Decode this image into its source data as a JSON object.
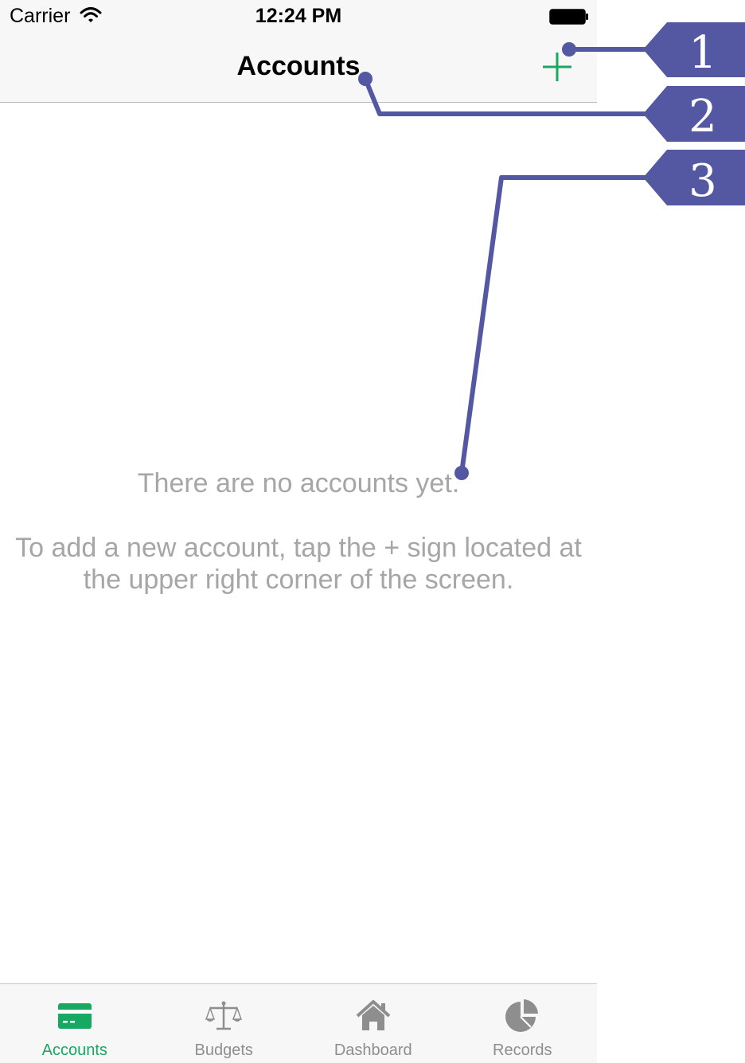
{
  "status_bar": {
    "carrier": "Carrier",
    "time": "12:24 PM"
  },
  "nav": {
    "title": "Accounts",
    "add_icon": "plus-icon"
  },
  "empty_state": {
    "title": "There are no accounts yet.",
    "hint": "To add a new account, tap the + sign located at the upper right corner of the screen."
  },
  "tabs": [
    {
      "label": "Accounts",
      "icon": "card-icon",
      "active": true
    },
    {
      "label": "Budgets",
      "icon": "scale-icon",
      "active": false
    },
    {
      "label": "Dashboard",
      "icon": "home-icon",
      "active": false
    },
    {
      "label": "Records",
      "icon": "pie-chart-icon",
      "active": false
    }
  ],
  "callouts": [
    {
      "number": "1"
    },
    {
      "number": "2"
    },
    {
      "number": "3"
    }
  ],
  "colors": {
    "accent": "#17a862",
    "callout": "#5458a3",
    "muted_text": "#a6a6a6",
    "inactive_icon": "#8e8e8e"
  }
}
